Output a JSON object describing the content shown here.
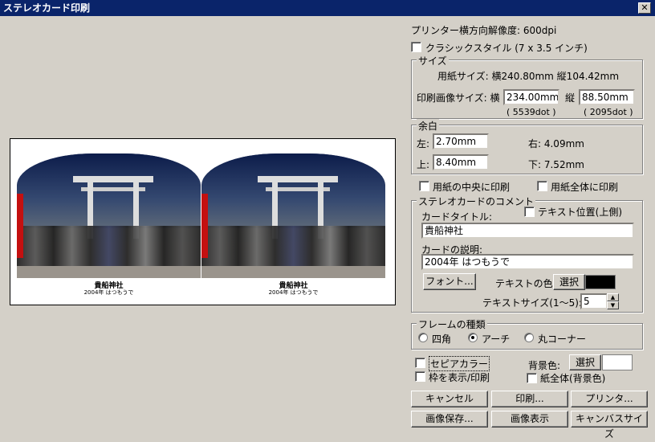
{
  "window": {
    "title": "ステレオカード印刷"
  },
  "printer_resolution": "プリンター横方向解像度: 600dpi",
  "classic_style": {
    "label": "クラシックスタイル (7 x 3.5 インチ)",
    "checked": false
  },
  "size": {
    "group_label": "サイズ",
    "paper_size": "用紙サイズ: 横240.80mm 縦104.42mm",
    "print_label": "印刷画像サイズ: 横",
    "width_value": "234.00mm",
    "height_label": "縦",
    "height_value": "88.50mm",
    "width_dots": "( 5539dot )",
    "height_dots": "( 2095dot )"
  },
  "margin": {
    "group_label": "余白",
    "left_label": "左:",
    "left_value": "2.70mm",
    "top_label": "上:",
    "top_value": "8.40mm",
    "right_text": "右: 4.09mm",
    "bottom_text": "下: 7.52mm"
  },
  "center_print": {
    "label": "用紙の中央に印刷",
    "checked": false
  },
  "full_print": {
    "label": "用紙全体に印刷",
    "checked": false
  },
  "comment": {
    "group_label": "ステレオカードのコメント",
    "title_label": "カードタイトル:",
    "text_position_label": "テキスト位置(上側)",
    "text_position_checked": false,
    "title_value": "貴船神社",
    "desc_label": "カードの説明:",
    "desc_value": "2004年 はつもうで",
    "font_button": "フォント...",
    "text_color_label": "テキストの色:",
    "select_button": "選択",
    "text_color": "#000000",
    "text_size_label": "テキストサイズ(1〜5):",
    "text_size_value": "5"
  },
  "frame": {
    "group_label": "フレームの種類",
    "options": [
      "四角",
      "アーチ",
      "丸コーナー"
    ],
    "selected": "アーチ"
  },
  "sepia": {
    "label": "セピアカラー",
    "checked": false
  },
  "show_frame": {
    "label": "枠を表示/印刷",
    "checked": false
  },
  "background": {
    "label": "背景色:",
    "select_button": "選択",
    "color": "#ffffff",
    "whole_paper_label": "紙全体(背景色)",
    "whole_paper_checked": false
  },
  "buttons": {
    "cancel": "キャンセル",
    "print": "印刷...",
    "printer": "プリンタ...",
    "save_image": "画像保存...",
    "show_image": "画像表示",
    "canvas_size": "キャンバスサイズ"
  },
  "preview": {
    "left_caption_title": "貴船神社",
    "left_caption_desc": "2004年 はつもうで",
    "right_caption_title": "貴船神社",
    "right_caption_desc": "2004年 はつもうで"
  }
}
